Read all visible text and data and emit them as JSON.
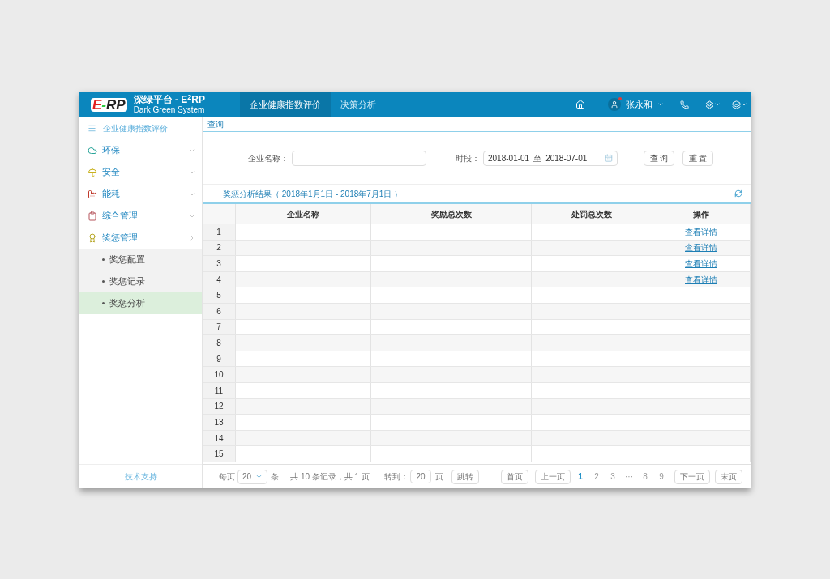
{
  "header": {
    "logo": [
      "E",
      "-",
      "RP"
    ],
    "title": "深绿平台 - E$^{2}$RP",
    "subtitle": "Dark Green System",
    "nav": [
      {
        "label": "企业健康指数评价",
        "selected": true
      },
      {
        "label": "决策分析",
        "selected": false
      }
    ],
    "user": {
      "name": "张永和"
    }
  },
  "sidebar": {
    "heading": "企业健康指数评价",
    "items": [
      {
        "label": "环保",
        "expanded": false
      },
      {
        "label": "安全",
        "expanded": false
      },
      {
        "label": "能耗",
        "expanded": false
      },
      {
        "label": "综合管理",
        "expanded": false
      },
      {
        "label": "奖惩管理",
        "expanded": true,
        "children": [
          {
            "label": "奖惩配置",
            "selected": false
          },
          {
            "label": "奖惩记录",
            "selected": false
          },
          {
            "label": "奖惩分析",
            "selected": true
          }
        ]
      }
    ],
    "footer": "技术支持"
  },
  "query": {
    "tab": "查询",
    "company_label": "企业名称：",
    "period_label": "时段：",
    "date_from": "2018-01-01",
    "date_sep": "至",
    "date_to": "2018-07-01",
    "buttons": [
      "查 询",
      "重 置"
    ]
  },
  "results": {
    "title": "奖惩分析结果（ 2018年1月1日 - 2018年7月1日 ）"
  },
  "table": {
    "columns": [
      "企业名称",
      "奖励总次数",
      "处罚总次数",
      "操作"
    ],
    "rows": [
      {
        "index": "1",
        "action": "查看详情"
      },
      {
        "index": "2",
        "action": "查看详情"
      },
      {
        "index": "3",
        "action": "查看详情"
      },
      {
        "index": "4",
        "action": "查看详情"
      },
      {
        "index": "5"
      },
      {
        "index": "6"
      },
      {
        "index": "7"
      },
      {
        "index": "8"
      },
      {
        "index": "9"
      },
      {
        "index": "10"
      },
      {
        "index": "11"
      },
      {
        "index": "12"
      },
      {
        "index": "13"
      },
      {
        "index": "14"
      },
      {
        "index": "15"
      }
    ]
  },
  "pagination": {
    "per_page_label": "每页",
    "per_page": "20",
    "per_page_unit": "条",
    "summary": "共 10 条记录，共 1 页",
    "goto_label": "转到：",
    "goto_value": "20",
    "goto_unit": "页",
    "goto_button": "跳转",
    "first": "首页",
    "prev": "上一页",
    "pages": [
      {
        "label": "1",
        "selected": true
      },
      {
        "label": "2",
        "selected": false
      },
      {
        "label": "3",
        "selected": false
      },
      {
        "label": "···",
        "selected": false
      },
      {
        "label": "8",
        "selected": false
      },
      {
        "label": "9",
        "selected": false
      }
    ],
    "next": "下一页",
    "last": "末页"
  }
}
